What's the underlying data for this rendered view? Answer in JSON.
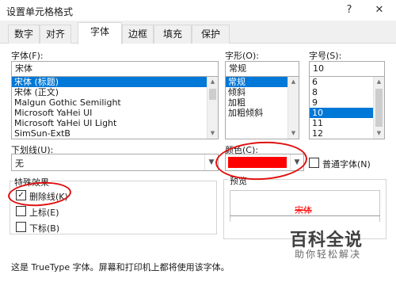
{
  "window": {
    "title": "设置单元格格式",
    "help_label": "?",
    "close_label": "✕"
  },
  "tabs": [
    {
      "label": "数字",
      "active": false
    },
    {
      "label": "对齐",
      "active": false
    },
    {
      "label": "字体",
      "active": true
    },
    {
      "label": "边框",
      "active": false
    },
    {
      "label": "填充",
      "active": false
    },
    {
      "label": "保护",
      "active": false
    }
  ],
  "font": {
    "label": "字体(F):",
    "value": "宋体",
    "options": [
      "宋体 (标题)",
      "宋体 (正文)",
      "Malgun Gothic Semilight",
      "Microsoft YaHei UI",
      "Microsoft YaHei UI Light",
      "SimSun-ExtB"
    ],
    "selected_index": 0
  },
  "style": {
    "label": "字形(O):",
    "value": "常规",
    "options": [
      "常规",
      "倾斜",
      "加粗",
      "加粗倾斜"
    ],
    "selected_index": 0
  },
  "size": {
    "label": "字号(S):",
    "value": "10",
    "options": [
      "6",
      "8",
      "9",
      "10",
      "11",
      "12"
    ],
    "selected_index": 3
  },
  "underline": {
    "label": "下划线(U):",
    "value": "无"
  },
  "color": {
    "label": "颜色(C):",
    "swatch": "#ff0000"
  },
  "normal_font": {
    "label": "普通字体(N)",
    "checked": false
  },
  "effects": {
    "label": "特殊效果",
    "items": [
      {
        "label": "删除线(K)",
        "checked": true
      },
      {
        "label": "上标(E)",
        "checked": false
      },
      {
        "label": "下标(B)",
        "checked": false
      }
    ]
  },
  "preview": {
    "label": "预览",
    "sample": "宋体",
    "sample_color": "#ff0000"
  },
  "footer_note": "这是 TrueType 字体。屏幕和打印机上都将使用该字体。",
  "watermark": {
    "brand": "百科全说",
    "tagline": "助你轻松解决"
  },
  "colors": {
    "selection": "#0078d7",
    "annotation": "#e01010"
  }
}
